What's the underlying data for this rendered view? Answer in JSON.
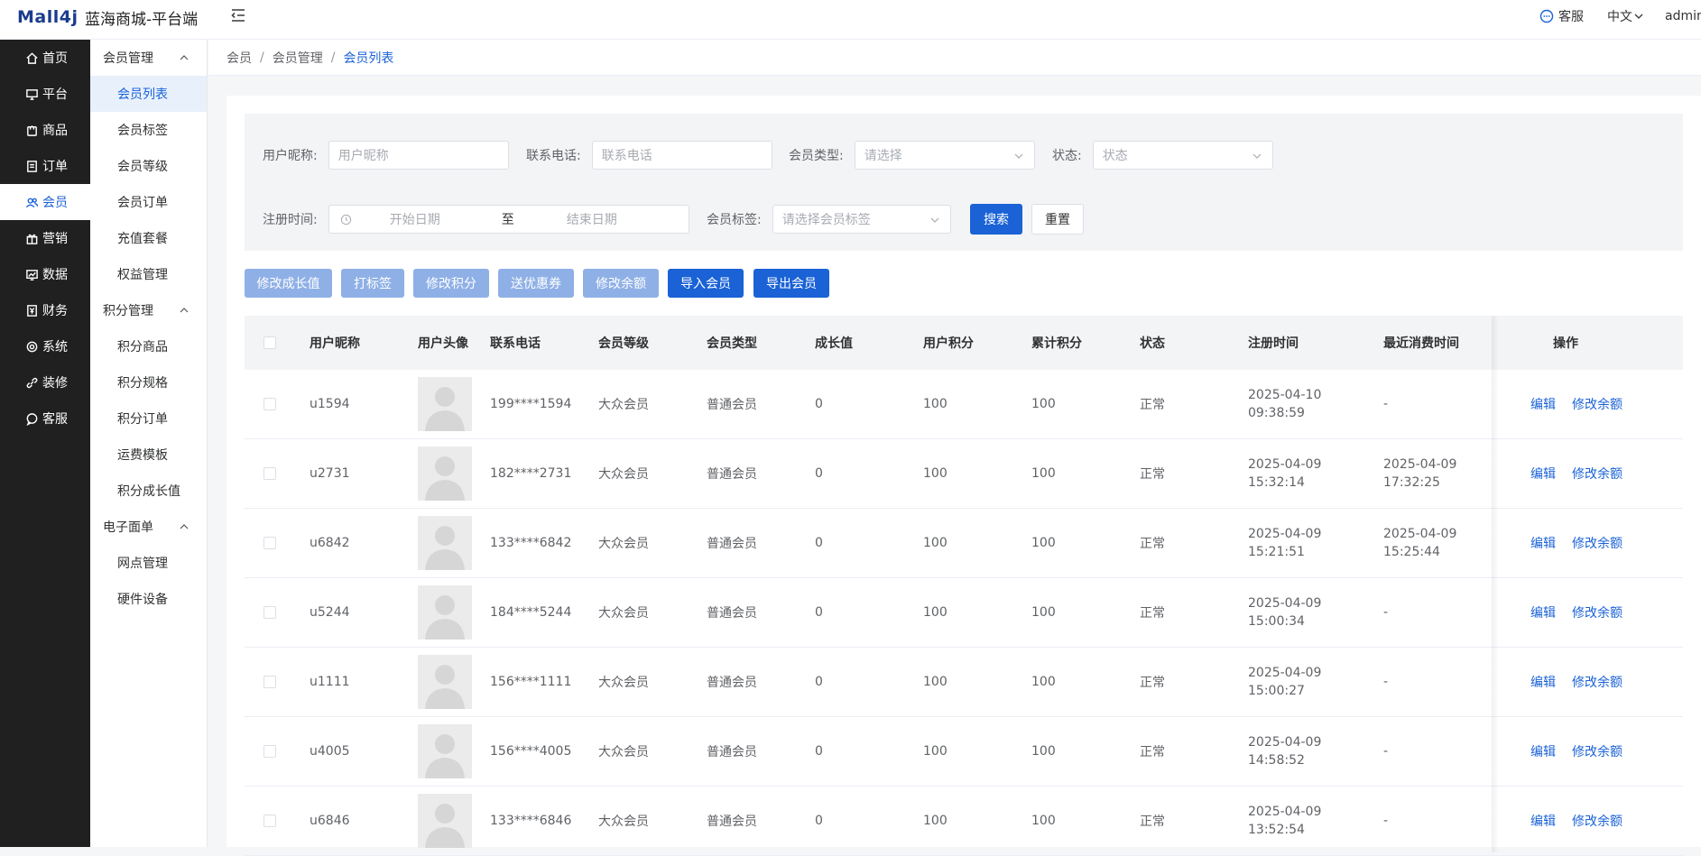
{
  "header": {
    "logo_text": "Mall4j",
    "brand": "蓝海商城-平台端",
    "kefu": "客服",
    "lang": "中文",
    "user": "admin"
  },
  "nav_main": [
    {
      "label": "首页",
      "icon": "home-icon"
    },
    {
      "label": "平台",
      "icon": "monitor-icon"
    },
    {
      "label": "商品",
      "icon": "bag-icon"
    },
    {
      "label": "订单",
      "icon": "document-icon"
    },
    {
      "label": "会员",
      "icon": "users-icon",
      "active": true
    },
    {
      "label": "营销",
      "icon": "gift-icon"
    },
    {
      "label": "数据",
      "icon": "chart-icon"
    },
    {
      "label": "财务",
      "icon": "finance-icon"
    },
    {
      "label": "系统",
      "icon": "gear-icon"
    },
    {
      "label": "装修",
      "icon": "link-icon"
    },
    {
      "label": "客服",
      "icon": "chat-icon"
    }
  ],
  "nav_sub": {
    "groups": [
      {
        "title": "会员管理",
        "items": [
          "会员列表",
          "会员标签",
          "会员等级",
          "会员订单",
          "充值套餐",
          "权益管理"
        ]
      },
      {
        "title": "积分管理",
        "items": [
          "积分商品",
          "积分规格",
          "积分订单",
          "运费模板",
          "积分成长值"
        ]
      },
      {
        "title": "电子面单",
        "items": [
          "网点管理",
          "硬件设备"
        ]
      }
    ],
    "active_item": "会员列表"
  },
  "breadcrumb": [
    "会员",
    "会员管理",
    "会员列表"
  ],
  "filters": {
    "nickname_label": "用户昵称:",
    "nickname_placeholder": "用户昵称",
    "phone_label": "联系电话:",
    "phone_placeholder": "联系电话",
    "type_label": "会员类型:",
    "type_placeholder": "请选择",
    "status_label": "状态:",
    "status_placeholder": "状态",
    "regtime_label": "注册时间:",
    "start_placeholder": "开始日期",
    "range_sep": "至",
    "end_placeholder": "结束日期",
    "tag_label": "会员标签:",
    "tag_placeholder": "请选择会员标签",
    "search_btn": "搜索",
    "reset_btn": "重置"
  },
  "actions": {
    "growth": "修改成长值",
    "tag": "打标签",
    "points": "修改积分",
    "coupon": "送优惠券",
    "balance": "修改余额",
    "import": "导入会员",
    "export": "导出会员"
  },
  "table": {
    "headers": [
      "用户昵称",
      "用户头像",
      "联系电话",
      "会员等级",
      "会员类型",
      "成长值",
      "用户积分",
      "累计积分",
      "状态",
      "注册时间",
      "最近消费时间",
      "操作"
    ],
    "op_edit": "编辑",
    "op_balance": "修改余额",
    "rows": [
      {
        "nick": "u1594",
        "phone": "199****1594",
        "level": "大众会员",
        "type": "普通会员",
        "growth": "0",
        "points": "100",
        "total": "100",
        "status": "正常",
        "reg": "2025-04-10\n09:38:59",
        "last": "-"
      },
      {
        "nick": "u2731",
        "phone": "182****2731",
        "level": "大众会员",
        "type": "普通会员",
        "growth": "0",
        "points": "100",
        "total": "100",
        "status": "正常",
        "reg": "2025-04-09\n15:32:14",
        "last": "2025-04-09\n17:32:25"
      },
      {
        "nick": "u6842",
        "phone": "133****6842",
        "level": "大众会员",
        "type": "普通会员",
        "growth": "0",
        "points": "100",
        "total": "100",
        "status": "正常",
        "reg": "2025-04-09\n15:21:51",
        "last": "2025-04-09\n15:25:44"
      },
      {
        "nick": "u5244",
        "phone": "184****5244",
        "level": "大众会员",
        "type": "普通会员",
        "growth": "0",
        "points": "100",
        "total": "100",
        "status": "正常",
        "reg": "2025-04-09\n15:00:34",
        "last": "-"
      },
      {
        "nick": "u1111",
        "phone": "156****1111",
        "level": "大众会员",
        "type": "普通会员",
        "growth": "0",
        "points": "100",
        "total": "100",
        "status": "正常",
        "reg": "2025-04-09\n15:00:27",
        "last": "-"
      },
      {
        "nick": "u4005",
        "phone": "156****4005",
        "level": "大众会员",
        "type": "普通会员",
        "growth": "0",
        "points": "100",
        "total": "100",
        "status": "正常",
        "reg": "2025-04-09\n14:58:52",
        "last": "-"
      },
      {
        "nick": "u6846",
        "phone": "133****6846",
        "level": "大众会员",
        "type": "普通会员",
        "growth": "0",
        "points": "100",
        "total": "100",
        "status": "正常",
        "reg": "2025-04-09\n13:52:54",
        "last": "-"
      }
    ]
  },
  "colors": {
    "primary": "#1a62d6",
    "sidebar_dark": "#202020",
    "light_button": "#8fb0e6"
  }
}
